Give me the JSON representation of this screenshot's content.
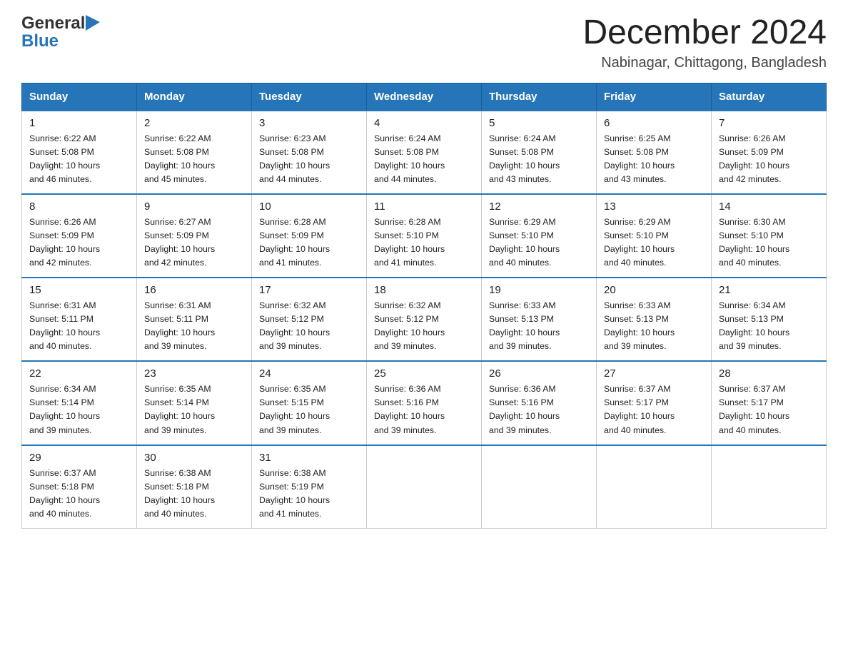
{
  "header": {
    "logo_general": "General",
    "logo_blue": "Blue",
    "month_year": "December 2024",
    "location": "Nabinagar, Chittagong, Bangladesh"
  },
  "days_of_week": [
    "Sunday",
    "Monday",
    "Tuesday",
    "Wednesday",
    "Thursday",
    "Friday",
    "Saturday"
  ],
  "weeks": [
    [
      {
        "day": "1",
        "sunrise": "6:22 AM",
        "sunset": "5:08 PM",
        "daylight": "10 hours and 46 minutes."
      },
      {
        "day": "2",
        "sunrise": "6:22 AM",
        "sunset": "5:08 PM",
        "daylight": "10 hours and 45 minutes."
      },
      {
        "day": "3",
        "sunrise": "6:23 AM",
        "sunset": "5:08 PM",
        "daylight": "10 hours and 44 minutes."
      },
      {
        "day": "4",
        "sunrise": "6:24 AM",
        "sunset": "5:08 PM",
        "daylight": "10 hours and 44 minutes."
      },
      {
        "day": "5",
        "sunrise": "6:24 AM",
        "sunset": "5:08 PM",
        "daylight": "10 hours and 43 minutes."
      },
      {
        "day": "6",
        "sunrise": "6:25 AM",
        "sunset": "5:08 PM",
        "daylight": "10 hours and 43 minutes."
      },
      {
        "day": "7",
        "sunrise": "6:26 AM",
        "sunset": "5:09 PM",
        "daylight": "10 hours and 42 minutes."
      }
    ],
    [
      {
        "day": "8",
        "sunrise": "6:26 AM",
        "sunset": "5:09 PM",
        "daylight": "10 hours and 42 minutes."
      },
      {
        "day": "9",
        "sunrise": "6:27 AM",
        "sunset": "5:09 PM",
        "daylight": "10 hours and 42 minutes."
      },
      {
        "day": "10",
        "sunrise": "6:28 AM",
        "sunset": "5:09 PM",
        "daylight": "10 hours and 41 minutes."
      },
      {
        "day": "11",
        "sunrise": "6:28 AM",
        "sunset": "5:10 PM",
        "daylight": "10 hours and 41 minutes."
      },
      {
        "day": "12",
        "sunrise": "6:29 AM",
        "sunset": "5:10 PM",
        "daylight": "10 hours and 40 minutes."
      },
      {
        "day": "13",
        "sunrise": "6:29 AM",
        "sunset": "5:10 PM",
        "daylight": "10 hours and 40 minutes."
      },
      {
        "day": "14",
        "sunrise": "6:30 AM",
        "sunset": "5:10 PM",
        "daylight": "10 hours and 40 minutes."
      }
    ],
    [
      {
        "day": "15",
        "sunrise": "6:31 AM",
        "sunset": "5:11 PM",
        "daylight": "10 hours and 40 minutes."
      },
      {
        "day": "16",
        "sunrise": "6:31 AM",
        "sunset": "5:11 PM",
        "daylight": "10 hours and 39 minutes."
      },
      {
        "day": "17",
        "sunrise": "6:32 AM",
        "sunset": "5:12 PM",
        "daylight": "10 hours and 39 minutes."
      },
      {
        "day": "18",
        "sunrise": "6:32 AM",
        "sunset": "5:12 PM",
        "daylight": "10 hours and 39 minutes."
      },
      {
        "day": "19",
        "sunrise": "6:33 AM",
        "sunset": "5:13 PM",
        "daylight": "10 hours and 39 minutes."
      },
      {
        "day": "20",
        "sunrise": "6:33 AM",
        "sunset": "5:13 PM",
        "daylight": "10 hours and 39 minutes."
      },
      {
        "day": "21",
        "sunrise": "6:34 AM",
        "sunset": "5:13 PM",
        "daylight": "10 hours and 39 minutes."
      }
    ],
    [
      {
        "day": "22",
        "sunrise": "6:34 AM",
        "sunset": "5:14 PM",
        "daylight": "10 hours and 39 minutes."
      },
      {
        "day": "23",
        "sunrise": "6:35 AM",
        "sunset": "5:14 PM",
        "daylight": "10 hours and 39 minutes."
      },
      {
        "day": "24",
        "sunrise": "6:35 AM",
        "sunset": "5:15 PM",
        "daylight": "10 hours and 39 minutes."
      },
      {
        "day": "25",
        "sunrise": "6:36 AM",
        "sunset": "5:16 PM",
        "daylight": "10 hours and 39 minutes."
      },
      {
        "day": "26",
        "sunrise": "6:36 AM",
        "sunset": "5:16 PM",
        "daylight": "10 hours and 39 minutes."
      },
      {
        "day": "27",
        "sunrise": "6:37 AM",
        "sunset": "5:17 PM",
        "daylight": "10 hours and 40 minutes."
      },
      {
        "day": "28",
        "sunrise": "6:37 AM",
        "sunset": "5:17 PM",
        "daylight": "10 hours and 40 minutes."
      }
    ],
    [
      {
        "day": "29",
        "sunrise": "6:37 AM",
        "sunset": "5:18 PM",
        "daylight": "10 hours and 40 minutes."
      },
      {
        "day": "30",
        "sunrise": "6:38 AM",
        "sunset": "5:18 PM",
        "daylight": "10 hours and 40 minutes."
      },
      {
        "day": "31",
        "sunrise": "6:38 AM",
        "sunset": "5:19 PM",
        "daylight": "10 hours and 41 minutes."
      },
      null,
      null,
      null,
      null
    ]
  ],
  "labels": {
    "sunrise": "Sunrise:",
    "sunset": "Sunset:",
    "daylight": "Daylight:"
  }
}
